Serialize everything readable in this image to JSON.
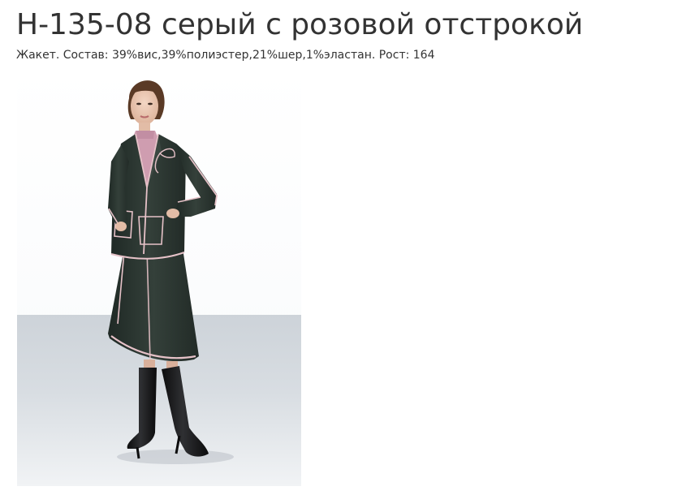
{
  "product": {
    "title": "Н-135-08 серый с розовой отстрокой",
    "description": "Жакет. Состав: 39%вис,39%полиэстер,21%шер,1%эластан. Рост: 164"
  },
  "photo": {
    "icon": "model-wearing-grey-jacket-and-skirt-image"
  },
  "colors": {
    "text": "#333333",
    "background": "#ffffff",
    "suit": "#2b3631",
    "piping": "#e6c2c8",
    "blouse": "#cf9db0",
    "floor": "#cdd3d9"
  }
}
